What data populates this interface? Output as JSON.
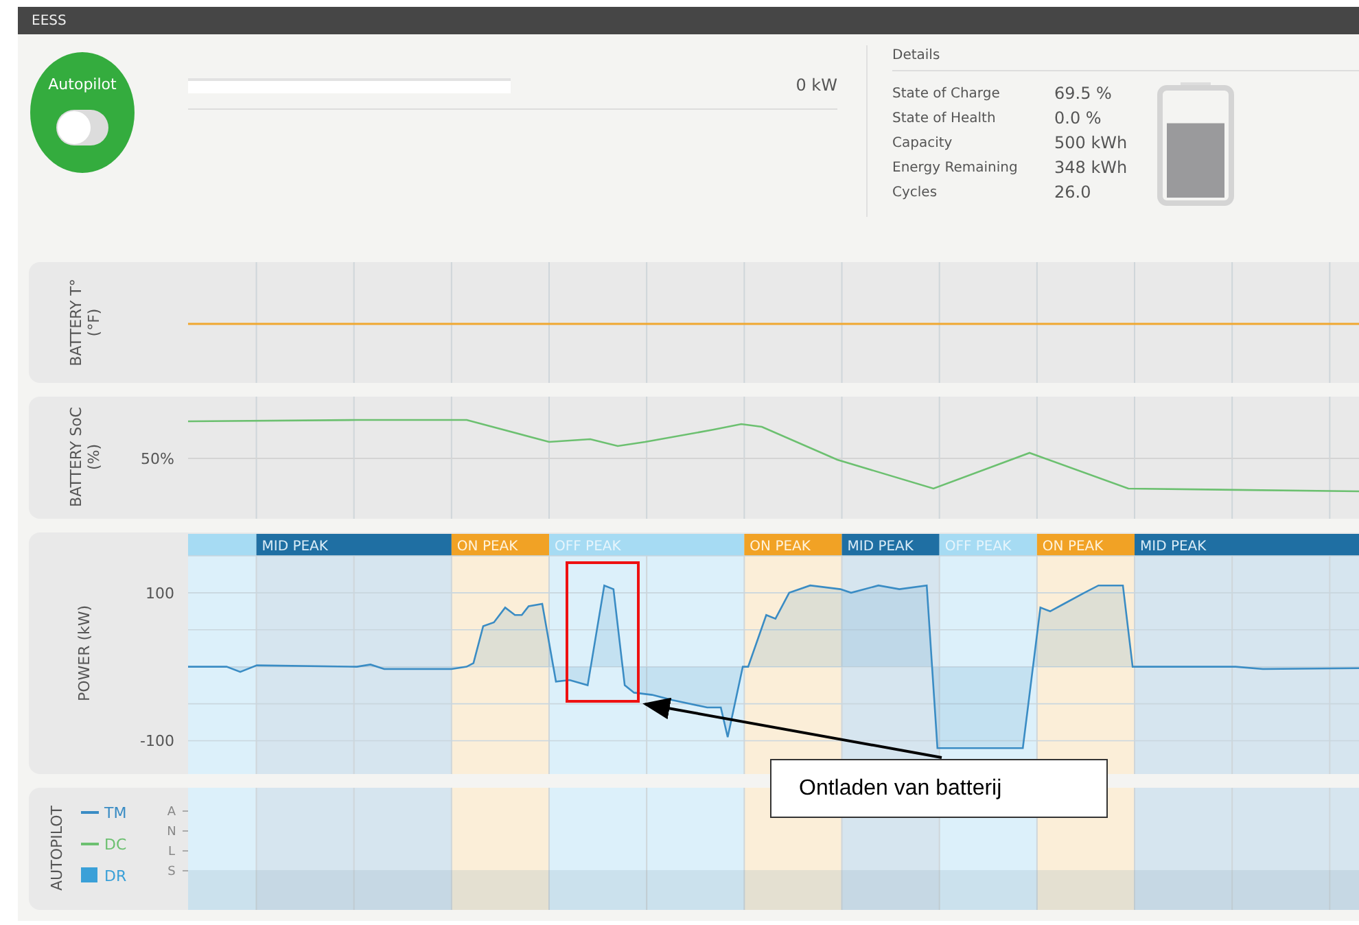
{
  "window": {
    "title": "EESS"
  },
  "autopilot": {
    "label": "Autopilot",
    "on": false
  },
  "power_meter": {
    "level": 0,
    "reading": "0 kW"
  },
  "details": {
    "title": "Details",
    "battery": {
      "level": 0.695
    },
    "rows": [
      {
        "label": "State of Charge",
        "value": "69.5 %"
      },
      {
        "label": "State of Health",
        "value": "0.0 %"
      },
      {
        "label": "Capacity",
        "value": "500 kWh"
      },
      {
        "label": "Energy Remaining",
        "value": "348 kWh"
      },
      {
        "label": "Cycles",
        "value": "26.0"
      }
    ]
  },
  "periods": [
    {
      "kind": "off"
    },
    {
      "kind": "mid",
      "label": "MID PEAK"
    },
    {
      "kind": "on",
      "label": "ON PEAK"
    },
    {
      "kind": "off",
      "label": "OFF PEAK"
    },
    {
      "kind": "on",
      "label": "ON PEAK"
    },
    {
      "kind": "mid",
      "label": "MID PEAK"
    },
    {
      "kind": "off",
      "label": "OFF PEAK"
    },
    {
      "kind": "on",
      "label": "ON PEAK"
    },
    {
      "kind": "mid",
      "label": "MID PEAK"
    }
  ],
  "temperature_panel": {
    "label": [
      "BATTERY T°",
      "(°F)"
    ]
  },
  "soc_panel": {
    "label": [
      "BATTERY SoC",
      "(%)"
    ],
    "tick": "50%"
  },
  "power_panel": {
    "label": "POWER (kW)",
    "ticks": [
      "100",
      "-100"
    ]
  },
  "autopilot_panel": {
    "label": "AUTOPILOT",
    "legend": [
      {
        "label": "TM",
        "kind": "line",
        "color": "#3a8cc4"
      },
      {
        "label": "DC",
        "kind": "line",
        "color": "#6cc070"
      },
      {
        "label": "DR",
        "kind": "square",
        "color": "#3aa0d8"
      }
    ],
    "levels": [
      "A",
      "N",
      "L",
      "S"
    ]
  },
  "annotation": {
    "text": "Ontladen van batterij"
  }
}
